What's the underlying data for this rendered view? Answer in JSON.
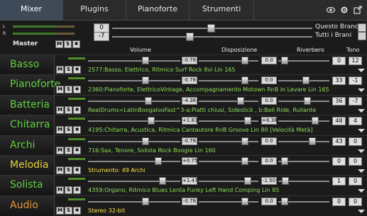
{
  "tabs": [
    {
      "label": "Mixer",
      "active": true
    },
    {
      "label": "Plugins"
    },
    {
      "label": "Pianoforte"
    },
    {
      "label": "Strumenti"
    }
  ],
  "master": {
    "label": "Master",
    "value_top": "0",
    "value_bottom": "-7",
    "option_top": "Questo Brano",
    "option_bottom": "Tutti i Brani"
  },
  "column_headers": {
    "volume": "Volume",
    "disposizione": "Disposizione",
    "riverbero": "Riverbero",
    "tono": "Tono"
  },
  "tracks": [
    {
      "name": "Basso",
      "volume": "-0.78",
      "disposizione": "0.0",
      "riverbero": "0",
      "tono": "12",
      "info": "2577:Basso, Elettrico, Ritmico Surf Rock 8vi Lin 165"
    },
    {
      "name": "Pianoforte",
      "volume": "-0.78",
      "disposizione": "0.0",
      "riverbero": "33",
      "tono": "-1",
      "info": "2360:Pianoforte, ElettricoVintage, Accompagnamento Motown RnB in Levare Lin 165"
    },
    {
      "name": "Batteria",
      "volume": "-4.36",
      "disposizione": "0.0",
      "riverbero": "36",
      "tono": "-7",
      "info": "RealDrums=LatinBoogalooFast^3-a:Piatti chiusi, Sidestick , b:Bell Ride, Rullante"
    },
    {
      "name": "Chitarra",
      "volume": "+1.83",
      "disposizione": "+8.38",
      "riverbero": "48",
      "tono": "4",
      "info": "4195:Chitarra, Acustica, Ritmica Cantautore RnB Groove Lin 80 [Velocità Metà]"
    },
    {
      "name": "Archi",
      "volume": "-0.78",
      "disposizione": "0.0",
      "riverbero": "43",
      "tono": "0",
      "info": "716:Sax, Tenore, Solista Rock Boogie Lin 160"
    },
    {
      "name": "Melodia",
      "volume": "+0.75",
      "disposizione": "0.0",
      "riverbero": "0",
      "tono": "0",
      "info": "Strumento: 49 Archi"
    },
    {
      "name": "Solista",
      "volume": "+1.47",
      "disposizione": "-1.50",
      "riverbero": "1",
      "tono": "0",
      "info": "4359:Organo, Ritmico  Blues Lenta Funky Left Hand Comping Lin 85"
    },
    {
      "name": "Audio",
      "volume": "-0.78",
      "disposizione": "0.0",
      "riverbero": "0",
      "tono": "0",
      "info": "Stereo 32-bit"
    }
  ],
  "colors": {
    "name_green": "#5fcf3e",
    "name_yellow": "#e8d23c",
    "name_orange": "#e8963a",
    "info_green": "#8fe05a",
    "info_yellow": "#ffe24a"
  }
}
